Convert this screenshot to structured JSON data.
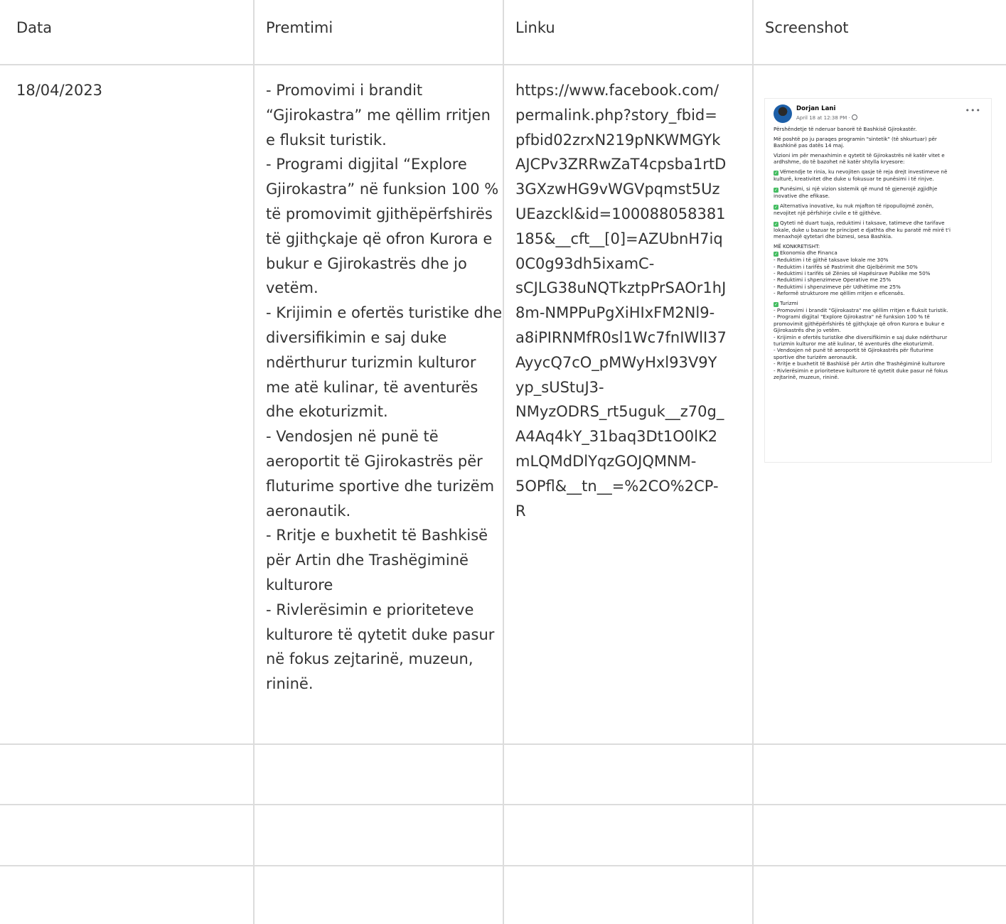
{
  "table": {
    "headers": [
      "Data",
      "Premtimi",
      "Linku",
      "Screenshot"
    ],
    "rows": [
      {
        "date": "18/04/2023",
        "promise_lines": [
          "- Promovimi i brandit “Gjirokastra” me qëllim rritjen e fluksit turistik.",
          "- Programi digjital “Explore Gjirokastra” në funksion 100 % të promovimit gjithëpërfshirës të gjithçkaje që ofron Kurora e bukur e Gjirokastrës dhe jo vetëm.",
          "- Krijimin e ofertës turistike dhe diversifikimin e saj duke ndërthurur turizmin kulturor me atë kulinar, të aventurës dhe ekoturizmit.",
          "- Vendosjen në punë të aeroportit të Gjirokastrës për fluturime sportive dhe turizëm aeronautik.",
          "- Rritje e buxhetit të Bashkisë për Artin dhe Trashëgiminë kulturore",
          "- Rivlerësimin e prioriteteve kulturore të qytetit duke pasur në fokus zejtarinë, muzeun, rininë."
        ],
        "link": "https://www.facebook.com/permalink.php?story_fbid=pfbid02zrxN219pNKWMGYkAJCPv3ZRRwZaT4cpsba1rtD3GXzwHG9vWGVpqmst5UzUEazckl&id=100088058381185&__cft__[0]=AZUbnH7iq0C0g93dh5ixamC-sCJLG38uNQTkztpPrSAOr1hJ8m-NMPPuPgXiHIxFM2Nl9-a8iPIRNMfR0sl1Wc7fnIWlI37AyycQ7cO_pMWyHxl93V9Yyp_sUStuJ3-NMyzODRS_rt5uguk__z70g_A4Aq4kY_31baq3Dt1O0lK2mLQMdDlYqzGOJQMNM-5OPfl&__tn__=%2CO%2CP-R",
        "link_lines": [
          "https://www.facebook.com/",
          "permalink.php?story_fbid=",
          "pfbid02zrxN219pNKWMGYk",
          "AJCPv3ZRRwZaT4cpsba1rtD",
          "3GXzwHG9vWGVpqmst5Uz",
          "UEazckl&id=100088058381",
          "185&__cft__[0]=AZUbnH7iq",
          "0C0g93dh5ixamC-",
          "sCJLG38uNQTkztpPrSAOr1hJ",
          "8m-NMPPuPgXiHIxFM2Nl9-",
          "a8iPIRNMfR0sl1Wc7fnIWlI37",
          "AyycQ7cO_pMWyHxl93V9Y",
          "yp_sUStuJ3-",
          "NMyzODRS_rt5uguk__z70g_",
          "A4Aq4kY_31baq3Dt1O0lK2",
          "mLQMdDlYqzGOJQMNM-",
          "5OPfl&__tn__=%2CO%2CP-",
          "R"
        ]
      }
    ]
  },
  "screenshot": {
    "author": "Dorjan Lani",
    "meta": "April 18 at 12:38 PM · ",
    "globe_icon": "globe-icon",
    "more_icon": "more-dots-icon",
    "check_color": "#45bd62",
    "p1": "Përshëndetje të nderuar banorë të Bashkisë Gjirokastër.",
    "p2_lines": [
      "Më poshtë po ju paraqes programin \"sintetik\" (të shkurtuar) për",
      "Bashkinë pas datës 14 maj."
    ],
    "p3_lines": [
      "Vizioni im për menaxhimin e qytetit të Gjirokastrës në katër vitet e",
      "ardhshme, do të bazohet në katër shtylla kryesore:"
    ],
    "pillar1_lines": [
      "Vëmendje te rinia, ku nevojiten qasje të reja drejt investimeve në",
      "kulturë, kreativitet dhe duke u fokusuar te punësimi i të rinjve."
    ],
    "pillar2_lines": [
      "Punësimi, si një vizion sistemik që mund të gjenerojë zgjidhje",
      "inovative dhe efikase."
    ],
    "pillar3_lines": [
      "Alternativa inovative, ku nuk mjafton të ripopullojmë zonën,",
      "nevojitet një përfshirje civile e të gjithëve."
    ],
    "pillar4_lines": [
      "Qyteti në duart tuaja, reduktimi i taksave, tatimeve dhe tarifave",
      "lokale, duke u bazuar te principet e djathta dhe ku paratë më mirë t'i",
      "menaxhojë qytetari dhe biznesi, sesa Bashkia."
    ],
    "concrete_lines": [
      "MË KONKRETISHT:",
      "Ekonomia dhe Financa",
      "- Reduktim i të gjithë taksave lokale me 30%",
      "- Reduktim i tarifës së Pastrimit dhe Gjelbërimit me 50%",
      "- Reduktimi i tarifës së Zënies së Hapësirave Publike me 50%",
      "- Reduktimi i shpenzimeve Operative me 25%",
      "- Reduktimi i shpenzimeve për Udhëtime me 25%",
      "- Reformë strukturore me qëllim rritjen e eficensës."
    ],
    "tourism_lines": [
      "Turizmi",
      "- Promovimi i brandit \"Gjirokastra\" me qëllim rritjen e fluksit turistik.",
      "- Programi digjital \"Explore Gjirokastra\" në funksion 100 % të",
      "promovimit gjithëpërfshirës të gjithçkaje që ofron Kurora e bukur e",
      "Gjirokastrës dhe jo vetëm.",
      "- Krijimin e ofertës turistike dhe diversifikimin e saj duke ndërthurur",
      "turizmin kulturor me atë kulinar, të aventurës dhe ekoturizmit.",
      "- Vendosjen në punë të aeroportit të Gjirokastrës për fluturime",
      "sportive dhe turizëm aeronautik.",
      "- Rritje e buxhetit të Bashkisë për Artin dhe Trashëgiminë kulturore",
      "- Rivlerësimin e prioriteteve kulturore të qytetit duke pasur në fokus",
      "zejtarinë, muzeun, rininë."
    ]
  }
}
